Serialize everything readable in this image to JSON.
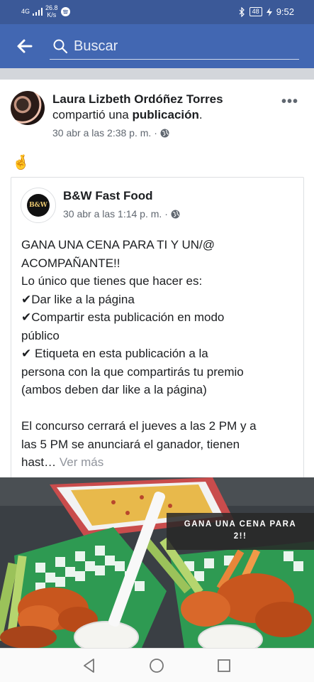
{
  "status_bar": {
    "network": "4G",
    "speed_value": "26.8",
    "speed_unit": "K/s",
    "battery": "48",
    "time": "9:52"
  },
  "search": {
    "placeholder": "Buscar"
  },
  "post": {
    "sharer_name": "Laura Lizbeth Ordóñez Torres",
    "action_prefix": "compartió una ",
    "action_object": "publicación",
    "action_suffix": ".",
    "timestamp": "30 abr a las 2:38 p. m. ·",
    "reaction_emoji": "🤞"
  },
  "shared_post": {
    "page_name": "B&W Fast Food",
    "logo_text": "B&W",
    "timestamp": "30 abr a las 1:14 p. m. ·",
    "lines": [
      "GANA UNA CENA PARA TI Y UN/@",
      "ACOMPAÑANTE!!",
      "Lo único que tienes que hacer es:"
    ],
    "check_items": [
      "Dar like a la página",
      "Compartir esta publicación en modo"
    ],
    "check_item_2_cont": "público",
    "check_item_3": " Etiqueta en esta publicación a la",
    "check_item_3_cont1": "persona con la que compartirás tu premio",
    "check_item_3_cont2": "(ambos deben dar like a la página)",
    "closing_1": "El concurso cerrará el jueves a las 2 PM y a",
    "closing_2": "las 5 PM se anunciará el ganador, tienen",
    "closing_3": "hast…",
    "see_more": "Ver más"
  },
  "photo": {
    "overlay_line1": "GANA UNA CENA PARA",
    "overlay_line2": "2!!"
  }
}
